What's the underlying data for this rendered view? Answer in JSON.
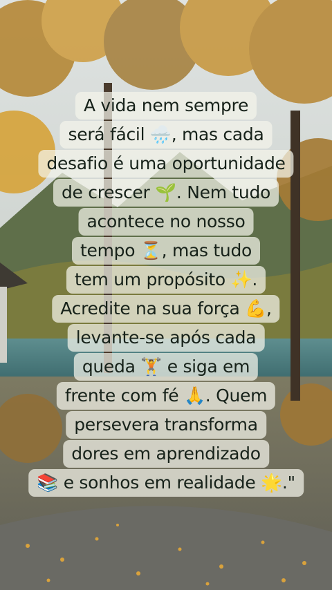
{
  "quote": {
    "lines": [
      "A vida nem sempre",
      "será fácil 🌧️, mas cada",
      "desafio é uma oportunidade",
      "de crescer 🌱. Nem tudo",
      "acontece no nosso",
      "tempo ⏳, mas tudo",
      "tem um propósito ✨.",
      "Acredite na sua força 💪,",
      "levante-se após cada",
      "queda 🏋️ e siga em",
      "frente com fé 🙏. Quem",
      "persevera transforma",
      "dores em aprendizado",
      "📚 e sonhos em realidade 🌟.\""
    ]
  },
  "colors": {
    "text": "#17221a",
    "text_panel": "#f4f4ea",
    "sky": "#e4e8e8",
    "foliage_autumn": "#c9993a",
    "lake": "#4c7d80",
    "ground": "#6f6e5e"
  }
}
